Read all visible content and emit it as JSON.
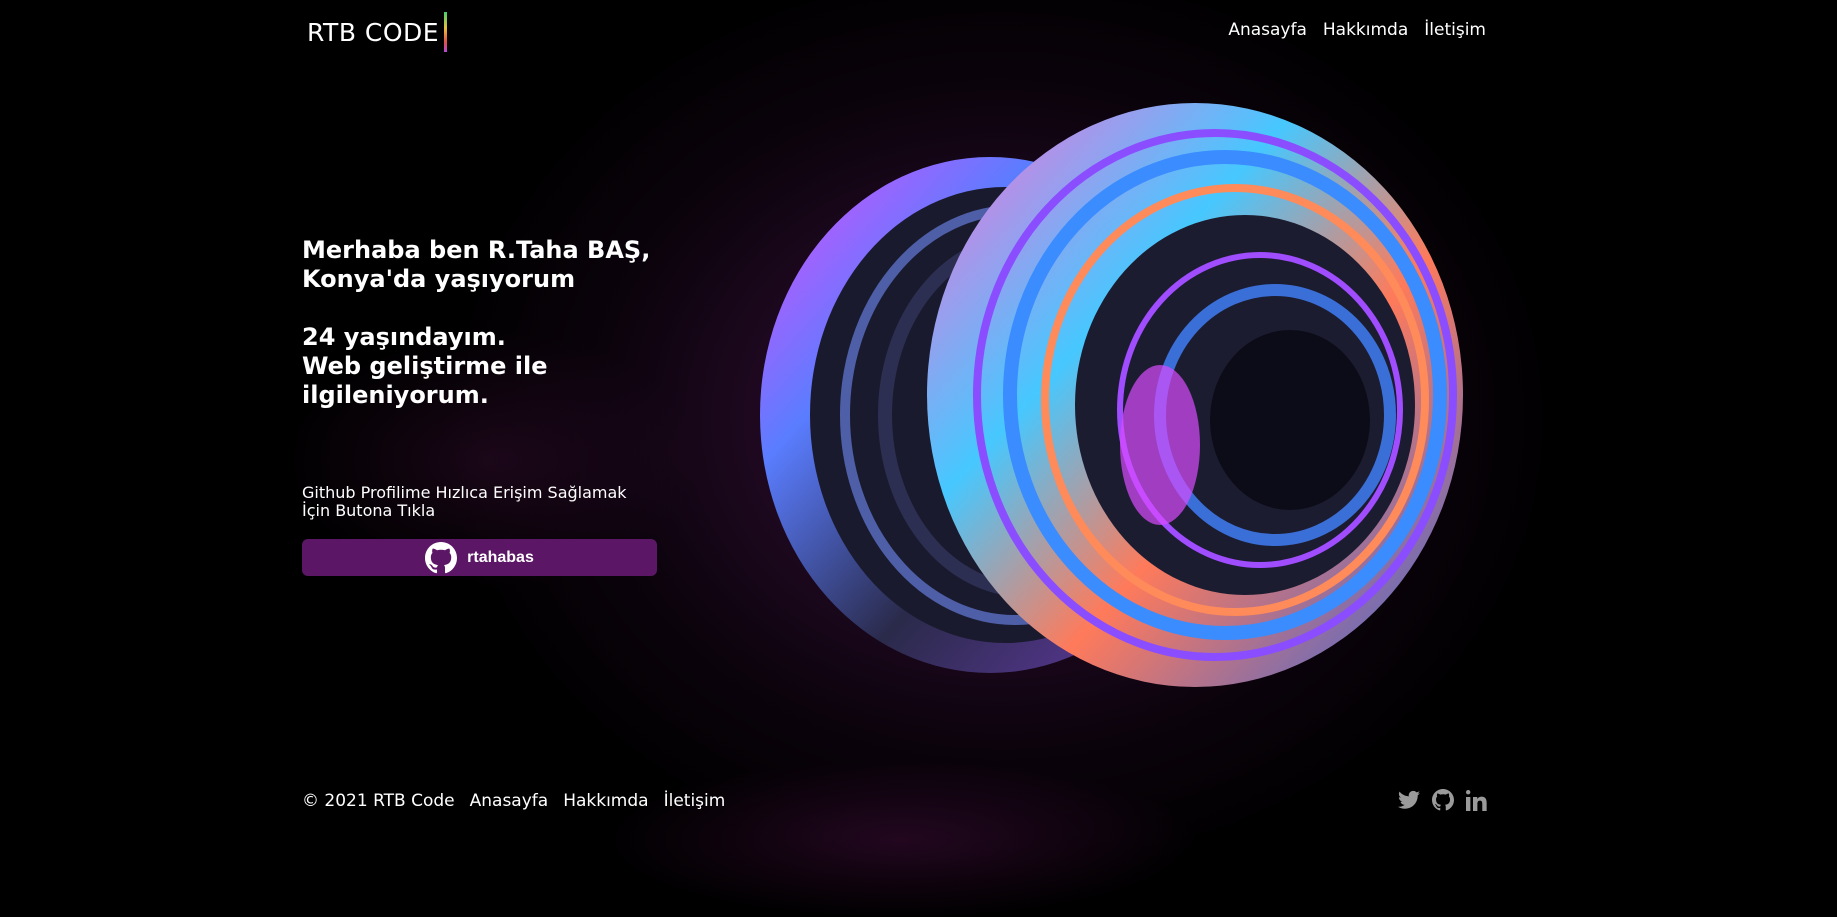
{
  "brand": {
    "logo_text": "RTB CODE"
  },
  "nav": {
    "items": [
      {
        "label": "Anasayfa"
      },
      {
        "label": "Hakkımda"
      },
      {
        "label": "İletişim"
      }
    ]
  },
  "hero": {
    "line1": "Merhaba ben R.Taha BAŞ,",
    "line2": "Konya'da yaşıyorum",
    "line3": "24 yaşındayım.",
    "line4": "Web geliştirme ile",
    "line5": "ilgileniyorum."
  },
  "cta": {
    "text_line1": "Github Profilime Hızlıca Erişim Sağlamak",
    "text_line2": "İçin Butona Tıkla",
    "button_label": "rtahabas",
    "button_icon": "github-icon"
  },
  "footer": {
    "copyright": "© 2021 RTB Code",
    "links": [
      {
        "label": "Anasayfa"
      },
      {
        "label": "Hakkımda"
      },
      {
        "label": "İletişim"
      }
    ],
    "social_icons": [
      "twitter-icon",
      "github-icon",
      "linkedin-icon"
    ]
  },
  "colors": {
    "background": "#000000",
    "button": "#5c1666",
    "text": "#ffffff",
    "social_icon": "#9a9a9a"
  }
}
